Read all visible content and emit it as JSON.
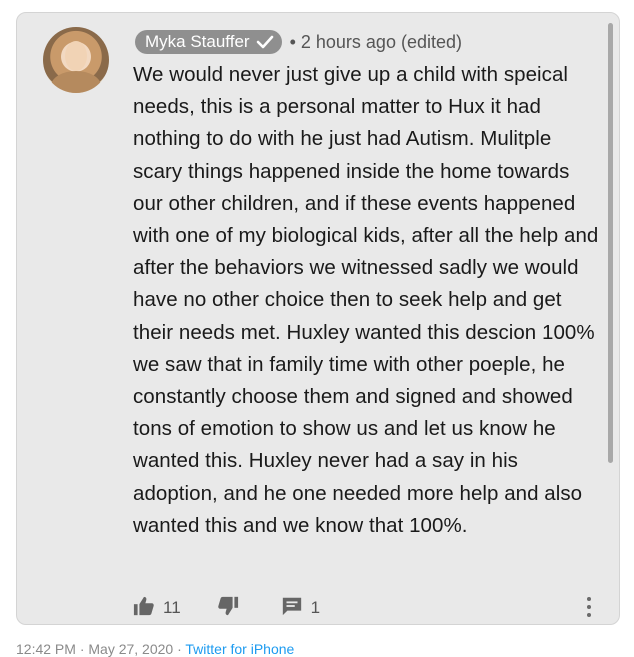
{
  "comment": {
    "author": "Myka Stauffer",
    "meta": "• 2 hours ago (edited)",
    "text": "We would never just give up a child with speical needs, this is a personal matter to Hux it had nothing to do with he just had Autism. Mulitple scary things happened inside the home towards our other children, and if these events happened with one of my biological kids, after all the help and after the behaviors we witnessed sadly we would have no other choice then to seek help and get their needs met. Huxley wanted this descion 100% we saw that in family time with other poeple, he constantly choose them and signed and showed tons of emotion to show us and let us know he wanted this. Huxley never had a say in his adoption, and he one needed more help and also wanted this and we know that 100%.",
    "like_count": "11",
    "reply_count": "1"
  },
  "tweet_footer": {
    "timestamp": "12:42 PM · May 27, 2020 · ",
    "source": "Twitter for iPhone"
  },
  "icons": {
    "verified": "check-icon",
    "like": "thumbs-up-icon",
    "dislike": "thumbs-down-icon",
    "reply": "comment-icon",
    "more": "more-vertical-icon"
  },
  "colors": {
    "card_bg": "#e9e9e9",
    "name_chip": "#8f8f8f",
    "link": "#1d9bf0"
  }
}
